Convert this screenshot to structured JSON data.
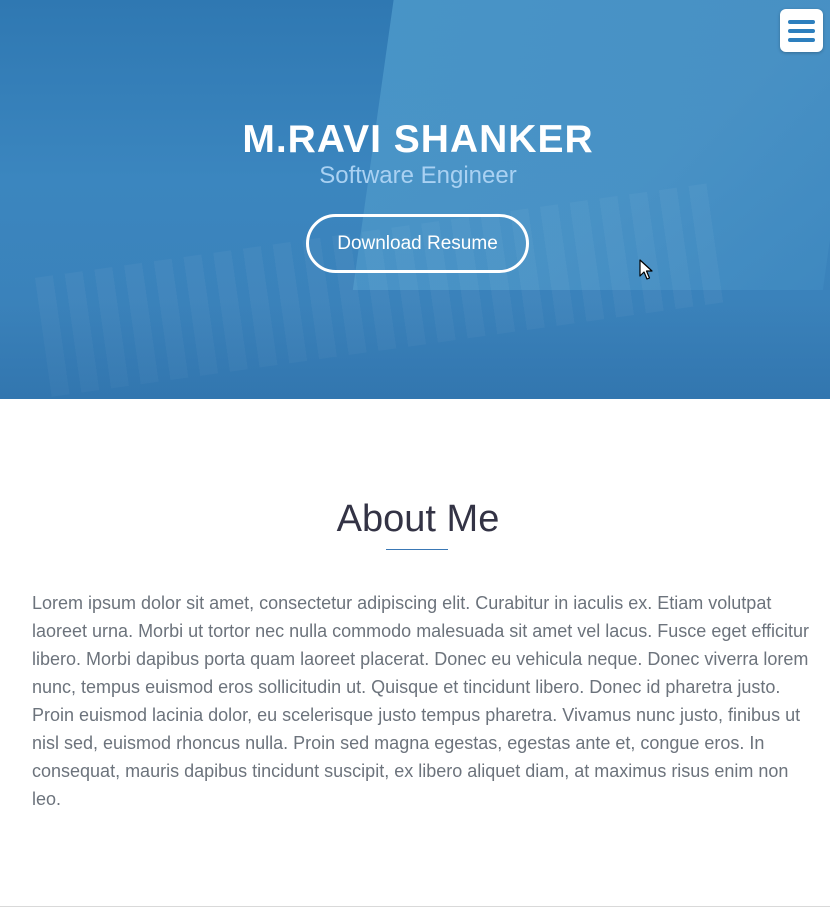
{
  "hero": {
    "name": "M.RAVI SHANKER",
    "role": "Software Engineer",
    "button_label": "Download Resume"
  },
  "about": {
    "title": "About Me",
    "body": "Lorem ipsum dolor sit amet, consectetur adipiscing elit. Curabitur in iaculis ex. Etiam volutpat laoreet urna. Morbi ut tortor nec nulla commodo malesuada sit amet vel lacus. Fusce eget efficitur libero. Morbi dapibus porta quam laoreet placerat. Donec eu vehicula neque. Donec viverra lorem nunc, tempus euismod eros sollicitudin ut. Quisque et tincidunt libero. Donec id pharetra justo. Proin euismod lacinia dolor, eu scelerisque justo tempus pharetra. Vivamus nunc justo, finibus ut nisl sed, euismod rhoncus nulla. Proin sed magna egestas, egestas ante et, congue eros. In consequat, mauris dapibus tincidunt suscipit, ex libero aliquet diam, at maximus risus enim non leo."
  },
  "icons": {
    "menu": "hamburger-menu-icon",
    "cursor": "mouse-cursor-icon"
  },
  "colors": {
    "hero_blue": "#3a7fb7",
    "accent": "#2d7fbe",
    "role_text": "#a9d1f2",
    "heading": "#333345",
    "body_text": "#6c737c"
  }
}
